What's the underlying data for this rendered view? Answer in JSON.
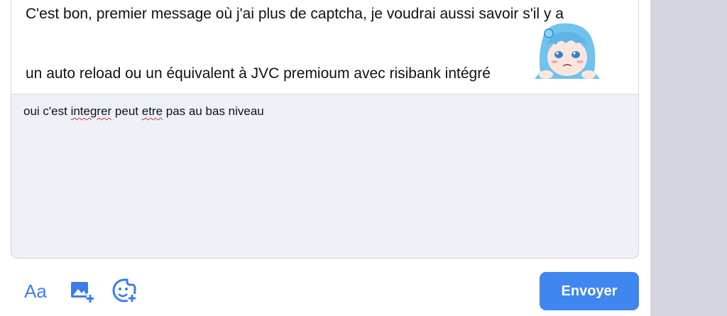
{
  "quoted_message": {
    "line1": "C'est bon, premier message où j'ai plus de captcha, je voudrai aussi savoir s'il y a",
    "line2": "un auto reload ou un équivalent à JVC premioum avec risibank intégré"
  },
  "editor": {
    "text_before": "oui c'est ",
    "word1": "integrer",
    "text_middle": " peut ",
    "word2": "etre",
    "text_after": " pas au bas niveau"
  },
  "toolbar": {
    "format_label": "Aa",
    "format_icon": "text-format-icon",
    "image_icon": "add-image-icon",
    "sticker_icon": "add-sticker-icon",
    "accent_color": "#3f86ee"
  },
  "send_button": {
    "label": "Envoyer"
  }
}
